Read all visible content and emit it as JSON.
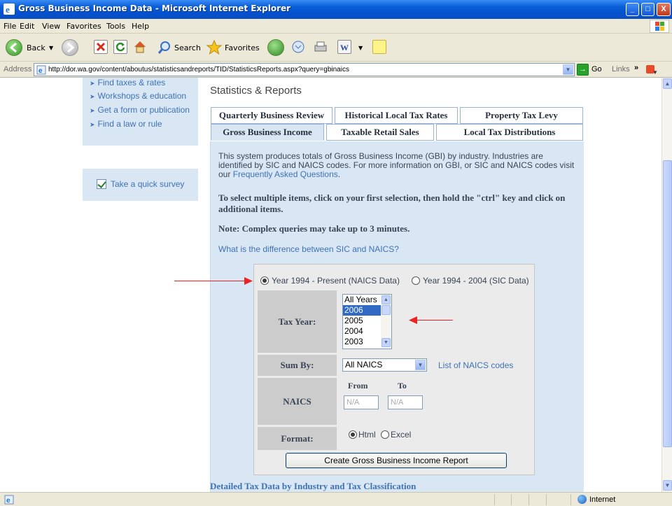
{
  "window": {
    "title": "Gross Business Income Data - Microsoft Internet Explorer",
    "min_label": "_",
    "max_label": "□",
    "close_label": "X"
  },
  "menu": [
    "File",
    "Edit",
    "View",
    "Favorites",
    "Tools",
    "Help"
  ],
  "toolbar": {
    "back": "Back",
    "search": "Search",
    "favorites": "Favorites"
  },
  "address": {
    "label": "Address",
    "url": "http://dor.wa.gov/content/aboutus/statisticsandreports/TID/StatisticsReports.aspx?query=gbinaics",
    "go": "Go",
    "links": "Links",
    "chevron": "»"
  },
  "leftnav": {
    "items": [
      "Find taxes & rates",
      "Workshops & education",
      "Get a form or publication",
      "Find a law or rule"
    ],
    "survey": "Take a quick survey"
  },
  "page": {
    "title": "Statistics & Reports",
    "tabs_row1": [
      "Quarterly Business Review",
      "Historical Local Tax Rates",
      "Property Tax Levy"
    ],
    "tabs_row2": [
      "Gross Business Income",
      "Taxable Retail Sales",
      "Local Tax Distributions"
    ],
    "intro": "This system produces totals of Gross Business Income (GBI) by industry. Industries are identified by SIC and NAICS codes. For more information on GBI, or SIC and NAICS codes visit our ",
    "faq_link": "Frequently Asked Questions",
    "intro_end": ".",
    "instructions": "To select multiple items, click on your first selection, then hold the \"ctrl\" key and click on additional items.",
    "note": "Note: Complex queries may take up to 3 minutes.",
    "diff_link": "What is the difference between SIC and NAICS?",
    "detailed_link": "Detailed Tax Data by Industry and Tax Classification"
  },
  "form": {
    "radio_naics": "Year 1994 - Present (NAICS Data)",
    "radio_sic": "Year 1994 - 2004 (SIC Data)",
    "tax_year_label": "Tax Year:",
    "years": [
      "All Years",
      "2006",
      "2005",
      "2004",
      "2003"
    ],
    "selected_year": "2006",
    "sum_by_label": "Sum By:",
    "sum_by_value": "All NAICS",
    "naics_list_link": "List of NAICS codes",
    "naics_label": "NAICS",
    "from_label": "From",
    "to_label": "To",
    "from_value": "N/A",
    "to_value": "N/A",
    "format_label": "Format:",
    "format_html": "Html",
    "format_excel": "Excel",
    "create_button": "Create Gross Business Income Report"
  },
  "status": {
    "zone": "Internet"
  },
  "colors": {
    "title_bar": "#0a5fd8",
    "link": "#3f73b5",
    "panel": "#d9e6f4",
    "annotation_arrow": "#e22222"
  }
}
